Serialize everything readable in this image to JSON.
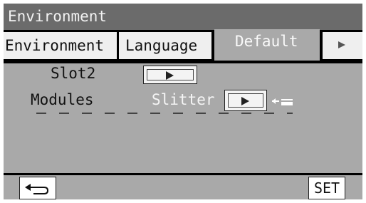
{
  "titlebar": {
    "title": "Environment"
  },
  "tabs": [
    {
      "label": "Environment",
      "active": false
    },
    {
      "label": "Language",
      "active": false
    },
    {
      "label": "Default",
      "active": true
    }
  ],
  "tab_more": {
    "icon": "triangle-right-icon"
  },
  "rows": {
    "slot": {
      "label": "Slot2",
      "button_icon": "triangle-right-icon"
    },
    "modules": {
      "label": "Modules",
      "value": "Slitter",
      "button_icon": "triangle-right-icon",
      "indicator_icon": "arrow-into-module-icon"
    }
  },
  "footer": {
    "back_icon": "return-arrow-icon",
    "set_label": "SET"
  },
  "colors": {
    "frame": "#000000",
    "panel": "#a9a9a9",
    "titlebar": "#6b6b6b",
    "tab": "#efefef"
  }
}
